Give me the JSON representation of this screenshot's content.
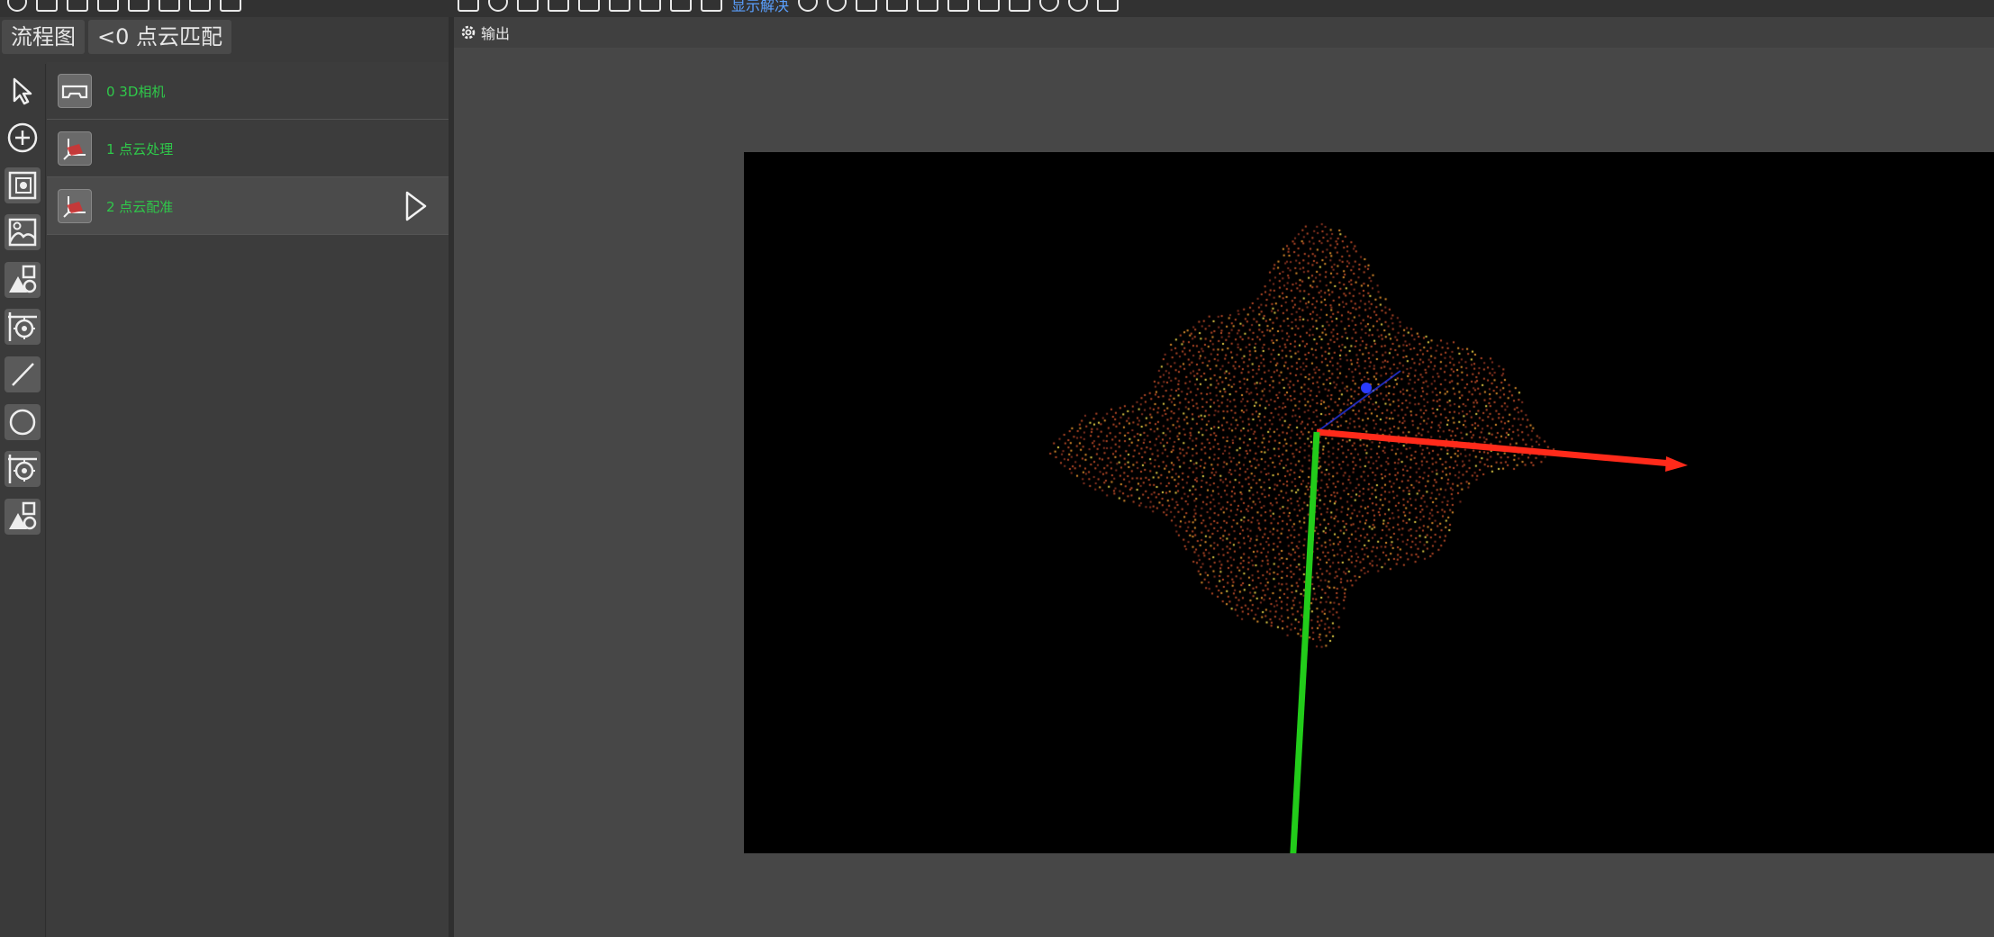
{
  "tabs": [
    {
      "label": "流程图"
    },
    {
      "label": "<0 点云匹配"
    }
  ],
  "toolbar": {
    "display_mode_label": "显示解决"
  },
  "node_list": {
    "items": [
      {
        "label": "0 3D相机",
        "icon": "camera-icon"
      },
      {
        "label": "1 点云处理",
        "icon": "point-cloud-icon"
      },
      {
        "label": "2 点云配准",
        "icon": "point-cloud-icon",
        "active": true
      }
    ]
  },
  "output": {
    "title": "输出"
  },
  "colors": {
    "node_label": "#2fc84a",
    "axis_x": "#ff2a1a",
    "axis_y": "#22cc1a",
    "axis_z": "#2a3cff",
    "link": "#5aa0ff"
  }
}
